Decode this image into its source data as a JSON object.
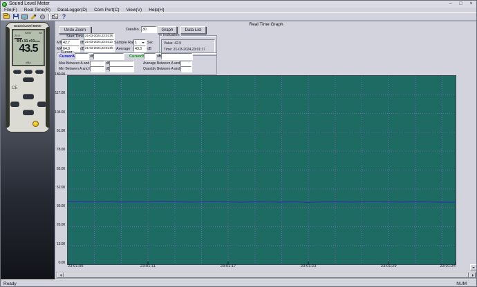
{
  "colors": {
    "plot_bg": "#1e6b63",
    "grid": "#7a6ab8",
    "line": "#2a35b0",
    "cursor_a": "#0000dd",
    "cursor_b": "#009b00"
  },
  "titlebar": {
    "title": "Sound Level Meter",
    "minimize": "–",
    "maximize": "□",
    "close": "×"
  },
  "menu": {
    "items": [
      "File(F)",
      "Real Time(R)",
      "DataLogger(D)",
      "Com Port(C)",
      "View(V)",
      "Help(H)"
    ]
  },
  "toolbar": {
    "icons": [
      "open-icon",
      "save-icon",
      "monitor-icon",
      "pen-icon",
      "record-icon",
      "separator",
      "print-icon",
      "help-icon"
    ]
  },
  "device": {
    "brand": "Sound Level Meter",
    "lcd": {
      "mode": "FAST",
      "range": "80",
      "aux_value": "29.5",
      "time": "04:31:01",
      "time_unit": "TIME",
      "value": "43.5",
      "unit": "dBA"
    },
    "ce_mark": "CE"
  },
  "graph": {
    "title": "Real Time Graph"
  },
  "controls": {
    "undo_zoom": "Undo Zoom",
    "data_no_label": "DataNo.",
    "data_no_value": "30",
    "graph_btn": "Graph",
    "data_list_btn": "Data List",
    "start_time_label": "Start Time",
    "start_time_value": "21-03-2024,23:01:05",
    "min_label": "MIN",
    "min_value": "42.7",
    "min_time": "21-03-2024,23:01:23",
    "max_label": "MAX",
    "max_value": "64.0",
    "max_time": "21-03-2024,23:01:05",
    "db_unit": "dB",
    "sample_rate_label": "Sample Rate",
    "sample_rate_value": "1",
    "sample_rate_unit": "Sec",
    "average_label": "Average",
    "average_value": "43.3",
    "indication_title": "Indication",
    "indication_value_label": "Value:",
    "indication_value": "42.9",
    "indication_time_label": "Time:",
    "indication_time": "21-03-2024,23:01:17",
    "cursor_title": "Cursor",
    "cursor_a": "CursorA",
    "cursor_b": "CursorB",
    "cursor_a_value": "",
    "cursor_a_time": "",
    "cursor_b_value": "",
    "cursor_b_time": "",
    "max_between": "Max Between A and B",
    "min_between": "Min Between A and B",
    "avg_between": "Average Between A and B",
    "qty_between": "Quantity Between A and B",
    "max_between_value": "",
    "min_between_value": "",
    "avg_between_value": "",
    "qty_between_value": ""
  },
  "chart_data": {
    "type": "line",
    "title": "Real Time Graph",
    "ylim": [
      0,
      130
    ],
    "ytick_step": 13,
    "y_ticks": [
      "130.00",
      "117.00",
      "104.00",
      "91.00",
      "78.00",
      "65.00",
      "52.00",
      "39.00",
      "26.00",
      "13.00",
      "0.00"
    ],
    "x_ticks": [
      "23:01:05",
      "23:01:11",
      "23:01:17",
      "23:01:23",
      "23:01:29",
      "23:01:34"
    ],
    "x_tick_seconds": [
      0,
      6,
      12,
      18,
      24,
      29
    ],
    "x_span_seconds": 29,
    "sample_rate_sec": 1,
    "grid": true,
    "legend": false,
    "values": [
      43.4,
      43.1,
      43.0,
      43.2,
      42.9,
      43.1,
      43.0,
      43.3,
      43.1,
      42.9,
      43.0,
      43.2,
      43.0,
      42.8,
      43.1,
      43.0,
      42.9,
      43.1,
      42.7,
      43.0,
      43.1,
      42.9,
      43.0,
      43.2,
      43.0,
      42.9,
      43.1,
      43.0,
      42.8,
      42.9
    ]
  },
  "statusbar": {
    "left": "Ready",
    "right": "NUM"
  }
}
